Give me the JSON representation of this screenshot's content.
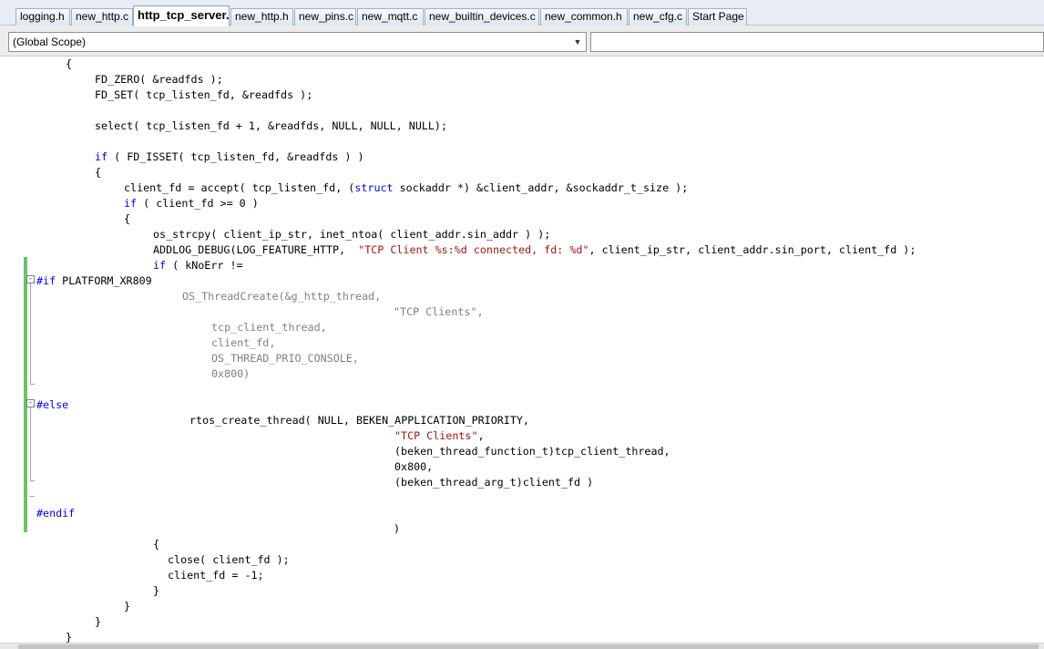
{
  "tabs": [
    {
      "label": "logging.h"
    },
    {
      "label": "new_http.c"
    },
    {
      "label": "http_tcp_server.c",
      "active": true
    },
    {
      "label": "new_http.h"
    },
    {
      "label": "new_pins.c"
    },
    {
      "label": "new_mqtt.c"
    },
    {
      "label": "new_builtin_devices.c"
    },
    {
      "label": "new_common.h"
    },
    {
      "label": "new_cfg.c"
    },
    {
      "label": "Start Page"
    }
  ],
  "scope": {
    "value": "(Global Scope)",
    "member_value": ""
  },
  "code": {
    "l1": "{",
    "l2": "FD_ZERO( &readfds );",
    "l3": "FD_SET( tcp_listen_fd, &readfds );",
    "l4": "select( tcp_listen_fd + 1, &readfds, NULL, NULL, NULL);",
    "l5_kw": "if",
    "l5": " ( FD_ISSET( tcp_listen_fd, &readfds ) )",
    "l6": "{",
    "l7a": "client_fd = accept( tcp_listen_fd, (",
    "l7_kw": "struct",
    "l7b": " sockaddr *) &client_addr, &sockaddr_t_size );",
    "l8_kw": "if",
    "l8": " ( client_fd >= 0 )",
    "l9": "{",
    "l10": "os_strcpy( client_ip_str, inet_ntoa( client_addr.sin_addr ) );",
    "l11a": "ADDLOG_DEBUG(LOG_FEATURE_HTTP,  ",
    "l11_str": "\"TCP Client %s:%d connected, fd: %d\"",
    "l11b": ", client_ip_str, client_addr.sin_port, client_fd );",
    "l12_kw": "if",
    "l12": " ( kNoErr !=",
    "l13_pp": "#if",
    "l13": " PLATFORM_XR809",
    "l14": "OS_ThreadCreate(&g_http_thread,",
    "l15": "\"TCP Clients\",",
    "l16": "tcp_client_thread,",
    "l17": "client_fd,",
    "l18": "OS_THREAD_PRIO_CONSOLE,",
    "l19": "0x800)",
    "l20_pp": "#else",
    "l21": "rtos_create_thread( NULL, BEKEN_APPLICATION_PRIORITY,",
    "l22_str": "\"TCP Clients\"",
    "l22": ",",
    "l23": "(beken_thread_function_t)tcp_client_thread,",
    "l24": "0x800,",
    "l25": "(beken_thread_arg_t)client_fd )",
    "l26_pp": "#endif",
    "l27": ")",
    "l28": "{",
    "l29": "close( client_fd );",
    "l30": "client_fd = -1;",
    "l31": "}",
    "l32": "}",
    "l33": "}",
    "l34": "}"
  }
}
